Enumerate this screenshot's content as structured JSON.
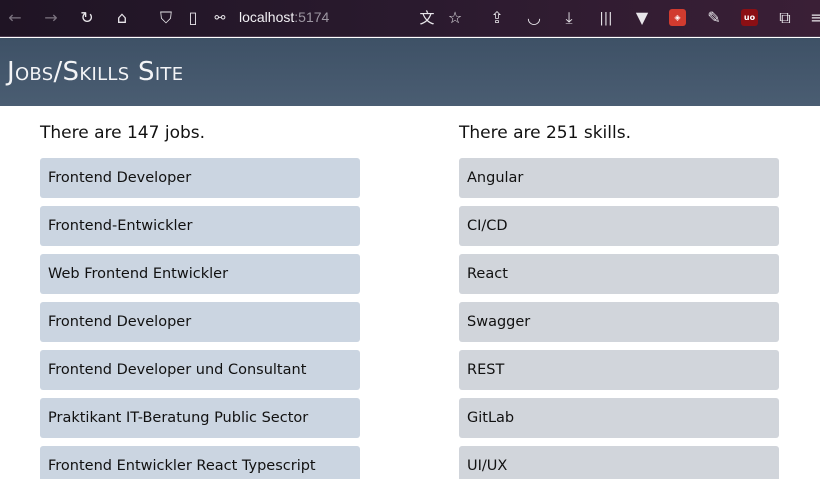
{
  "browser": {
    "url_host": "localhost",
    "url_port": ":5174"
  },
  "header": {
    "title": "Jobs/Skills Site"
  },
  "jobs": {
    "heading": "There are 147 jobs.",
    "items": [
      "Frontend Developer",
      "Frontend-Entwickler",
      "Web Frontend Entwickler",
      "Frontend Developer",
      "Frontend Developer und Consultant",
      "Praktikant IT-Beratung Public Sector",
      "Frontend Entwickler React Typescript"
    ]
  },
  "skills": {
    "heading": "There are 251 skills.",
    "items": [
      "Angular",
      "CI/CD",
      "React",
      "Swagger",
      "REST",
      "GitLab",
      "UI/UX"
    ]
  }
}
